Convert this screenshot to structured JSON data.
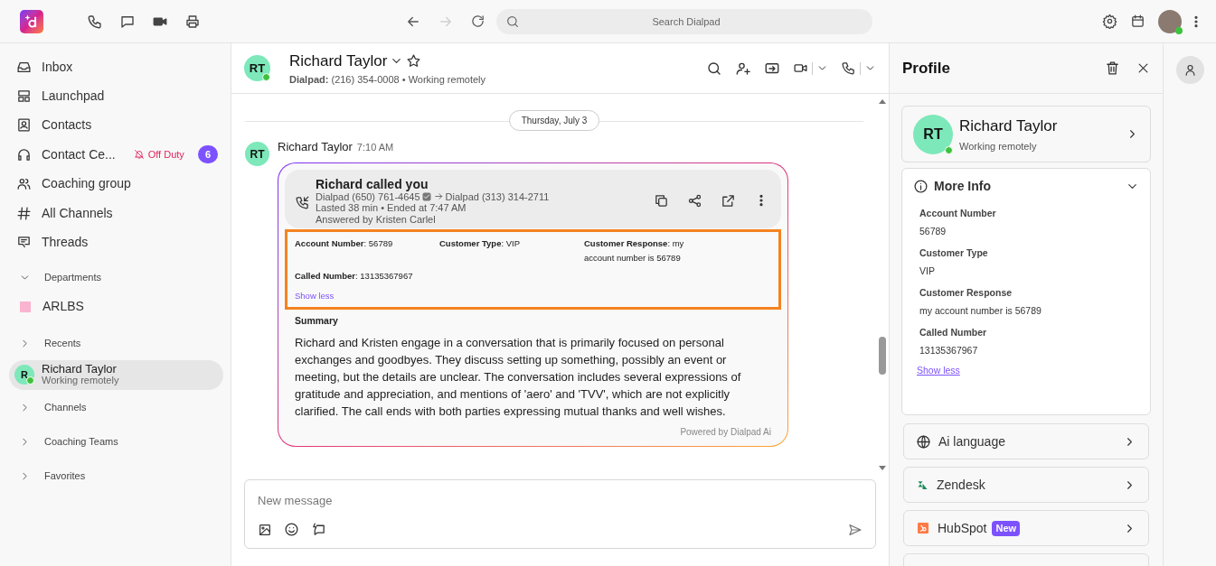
{
  "topbar": {
    "search": {
      "placeholder": "Search Dialpad"
    },
    "nav_buttons": [
      {
        "disabled": false
      },
      {
        "disabled": true
      }
    ],
    "user": {
      "online": true
    }
  },
  "sidebar": {
    "items": [
      {
        "kind": "nav",
        "label": "Inbox"
      },
      {
        "kind": "nav",
        "label": "Launchpad"
      },
      {
        "kind": "nav",
        "label": "Contacts"
      },
      {
        "kind": "nav",
        "label": "Contact Ce...",
        "status": "Off Duty",
        "badge": "6"
      },
      {
        "kind": "nav",
        "label": "Coaching group"
      },
      {
        "kind": "nav",
        "label": "All Channels"
      },
      {
        "kind": "nav",
        "label": "Threads"
      },
      {
        "kind": "section",
        "label": "Departments",
        "expanded": true
      },
      {
        "kind": "department",
        "label": "ARLBS",
        "color": "#f9b4cf"
      },
      {
        "kind": "section",
        "label": "Recents",
        "expanded": false
      },
      {
        "kind": "contact",
        "initial": "R",
        "name": "Richard Taylor",
        "subtitle": "Working remotely",
        "online": true,
        "selected": true
      },
      {
        "kind": "section",
        "label": "Channels",
        "expanded": false
      },
      {
        "kind": "section",
        "label": "Coaching Teams",
        "expanded": false
      },
      {
        "kind": "section",
        "label": "Favorites",
        "expanded": false
      }
    ]
  },
  "conversation": {
    "initials": "RT",
    "online": true,
    "name": "Richard Taylor",
    "starred": false,
    "line_label": "Dialpad:",
    "phone": "(216) 354-0008 • Working remotely",
    "date_divider": "Thursday, July 3",
    "message": {
      "initials": "RT",
      "author": "Richard Taylor",
      "time": "7:10 AM",
      "call": {
        "title": "Richard called you",
        "from": "Dialpad (650) 761-4645",
        "to": "Dialpad (313) 314-2711",
        "duration": "Lasted 38 min • Ended at 7:47 AM",
        "answered": "Answered by Kristen Carlel"
      },
      "fields": [
        "**Account Number**: 56789",
        "**Customer Type**: VIP",
        "**Customer Response**: my account number is 56789",
        "**Called Number**: 13135367967"
      ],
      "show_less": "Show less",
      "summary_title": "Summary",
      "summary": "Richard and Kristen engage in a conversation that is primarily focused on personal exchanges and goodbyes. They discuss setting up something, possibly an event or meeting, but the details are unclear. The conversation includes several expressions of gratitude and appreciation, and mentions of 'aero' and 'TVV', which are not explicitly clarified. The call ends with both parties expressing mutual thanks and well wishes.",
      "footer": "Powered by Dialpad Ai"
    },
    "composer": {
      "placeholder": "New message"
    }
  },
  "profile": {
    "title": "Profile",
    "contact": {
      "initials": "RT",
      "online": true,
      "name": "Richard Taylor",
      "status": "Working remotely"
    },
    "more_info": {
      "title": "More Info",
      "expanded": true,
      "fields": [
        {
          "label": "Account Number",
          "value": "56789"
        },
        {
          "label": "Customer Type",
          "value": "VIP"
        },
        {
          "label": "Customer Response",
          "value": "my account number is 56789"
        },
        {
          "label": "Called Number",
          "value": "13135367967"
        }
      ],
      "show_less": "Show less"
    },
    "integrations": [
      {
        "name": "Ai language"
      },
      {
        "name": "Zendesk"
      },
      {
        "name": "HubSpot",
        "badge": "New"
      }
    ]
  }
}
